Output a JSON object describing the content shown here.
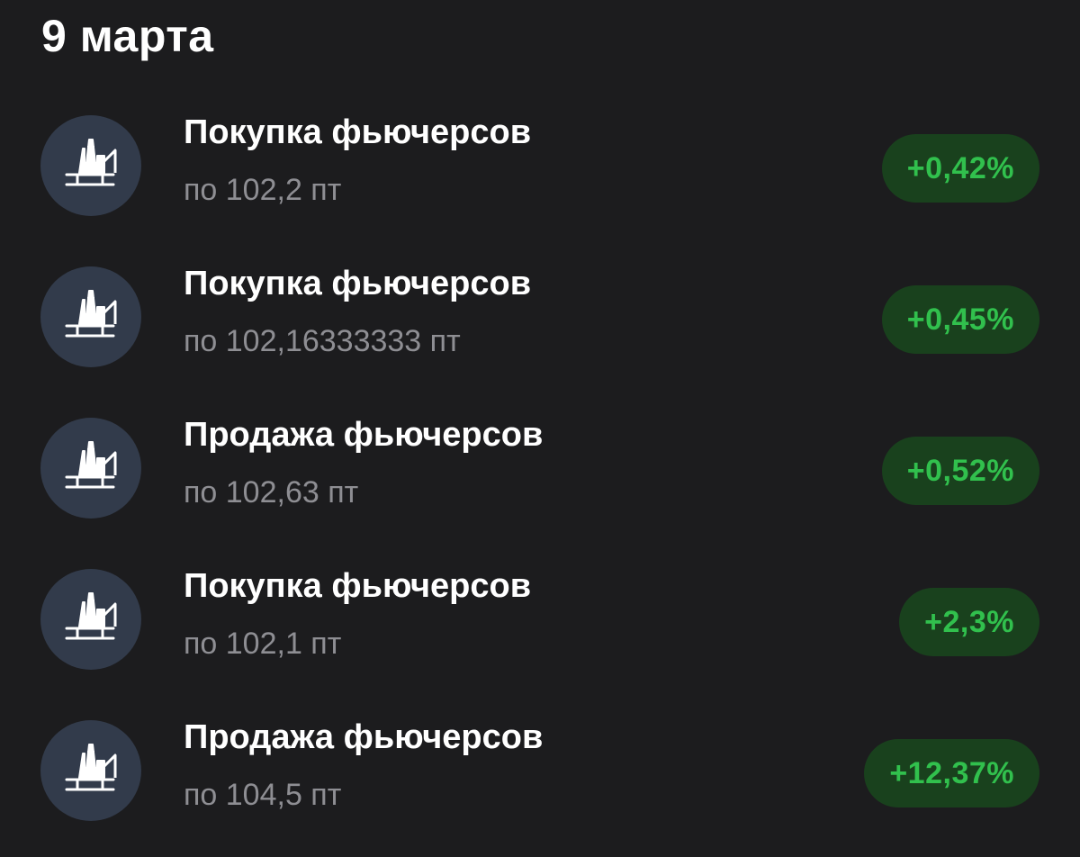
{
  "header": {
    "date": "9 марта"
  },
  "operations": [
    {
      "title": "Покупка фьючерсов",
      "price": "по 102,2 пт",
      "change": "+0,42%",
      "icon": "oil-platform-icon"
    },
    {
      "title": "Покупка фьючерсов",
      "price": "по 102,16333333 пт",
      "change": "+0,45%",
      "icon": "oil-platform-icon"
    },
    {
      "title": "Продажа фьючерсов",
      "price": "по 102,63 пт",
      "change": "+0,52%",
      "icon": "oil-platform-icon"
    },
    {
      "title": "Покупка фьючерсов",
      "price": "по 102,1 пт",
      "change": "+2,3%",
      "icon": "oil-platform-icon"
    },
    {
      "title": "Продажа фьючерсов",
      "price": "по 104,5 пт",
      "change": "+12,37%",
      "icon": "oil-platform-icon"
    }
  ],
  "colors": {
    "background": "#1c1c1e",
    "avatar_bg": "#323b4b",
    "badge_bg": "#19411d",
    "badge_text": "#31c04d",
    "secondary_text": "#8e8e93"
  }
}
